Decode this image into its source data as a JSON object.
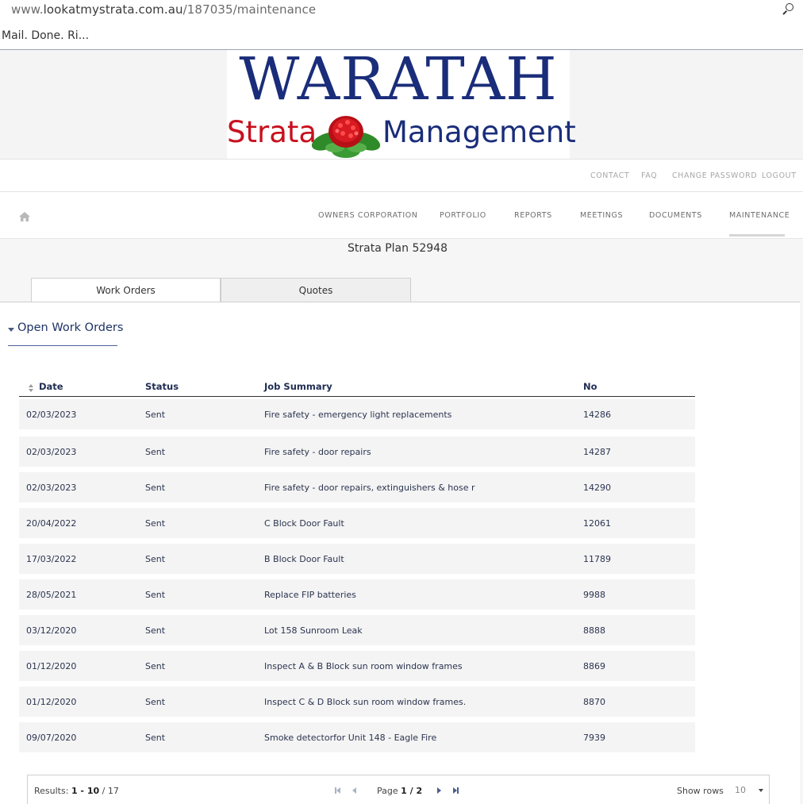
{
  "browser": {
    "url_prefix": "www.",
    "url_domain": "lookatmystrata.com.au",
    "url_path": "/187035/maintenance",
    "tab_title": "Mail. Done. Ri..."
  },
  "logo": {
    "title": "WARATAH",
    "word_left": "Strata",
    "word_right": "Management"
  },
  "utility_nav": [
    "CONTACT",
    "FAQ",
    "CHANGE PASSWORD",
    "LOGOUT"
  ],
  "main_nav": {
    "items": [
      "OWNERS CORPORATION",
      "PORTFOLIO",
      "REPORTS",
      "MEETINGS",
      "DOCUMENTS",
      "MAINTENANCE"
    ],
    "active": "MAINTENANCE"
  },
  "plan_title": "Strata Plan 52948",
  "tabs": [
    "Work Orders",
    "Quotes"
  ],
  "section_title": "Open Work Orders",
  "table": {
    "headers": [
      "Date",
      "Status",
      "Job Summary",
      "No"
    ],
    "rows": [
      [
        "02/03/2023",
        "Sent",
        "Fire safety - emergency light replacements",
        "14286"
      ],
      [
        "02/03/2023",
        "Sent",
        "Fire safety - door repairs",
        "14287"
      ],
      [
        "02/03/2023",
        "Sent",
        "Fire safety - door repairs, extinguishers & hose r",
        "14290"
      ],
      [
        "20/04/2022",
        "Sent",
        "C Block Door Fault",
        "12061"
      ],
      [
        "17/03/2022",
        "Sent",
        "B Block Door Fault",
        "11789"
      ],
      [
        "28/05/2021",
        "Sent",
        "Replace FIP batteries",
        "9988"
      ],
      [
        "03/12/2020",
        "Sent",
        "Lot 158 Sunroom Leak",
        "8888"
      ],
      [
        "01/12/2020",
        "Sent",
        "Inspect A & B Block sun room window frames",
        "8869"
      ],
      [
        "01/12/2020",
        "Sent",
        "Inspect C & D Block sun room window frames.",
        "8870"
      ],
      [
        "09/07/2020",
        "Sent",
        "Smoke detectorfor Unit 148 - Eagle Fire",
        "7939"
      ]
    ]
  },
  "pager": {
    "results_label": "Results:",
    "results_range": "1 - 10",
    "results_total": "/ 17",
    "page_label": "Page",
    "page_value": "1 / 2",
    "show_rows_label": "Show rows",
    "rows_value": "10"
  },
  "colors": {
    "brand_blue": "#1a2d7a",
    "brand_red": "#c8101e",
    "table_text": "#2b3450",
    "nav_text": "#6e6e6e"
  }
}
